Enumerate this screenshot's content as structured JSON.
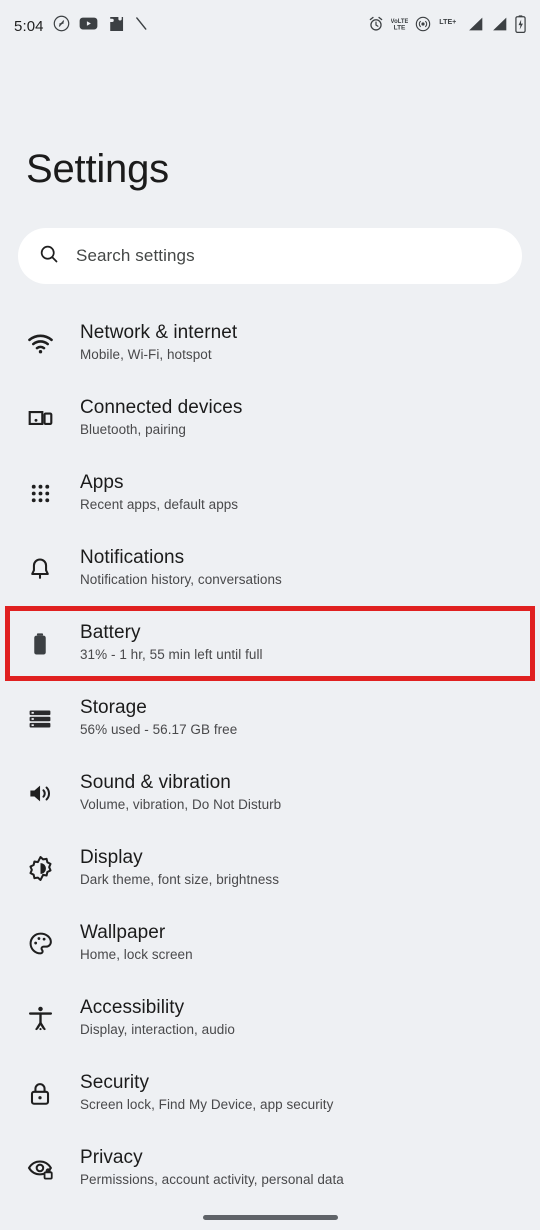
{
  "status_bar": {
    "time": "5:04",
    "left_icons": [
      "shazam-icon",
      "youtube-icon",
      "puzzle-piece-icon",
      "slash-icon"
    ],
    "right_icons": [
      "alarm-icon",
      "volte-icon",
      "hotspot-icon",
      "lte-plus-icon",
      "signal-bars-1-icon",
      "signal-bars-2-icon",
      "battery-charging-icon"
    ],
    "network_label": "LTE+",
    "volte_label_top": "VoLTE",
    "volte_label_bottom": "LTE"
  },
  "header": {
    "title": "Settings"
  },
  "search": {
    "placeholder": "Search settings",
    "icon": "search-icon"
  },
  "highlight": {
    "color": "#e02020",
    "target": "battery"
  },
  "items": [
    {
      "key": "network-internet",
      "icon": "wifi-icon",
      "title": "Network & internet",
      "subtitle": "Mobile, Wi-Fi, hotspot",
      "highlighted": false
    },
    {
      "key": "connected-devices",
      "icon": "devices-icon",
      "title": "Connected devices",
      "subtitle": "Bluetooth, pairing",
      "highlighted": false
    },
    {
      "key": "apps",
      "icon": "apps-grid-icon",
      "title": "Apps",
      "subtitle": "Recent apps, default apps",
      "highlighted": false
    },
    {
      "key": "notifications",
      "icon": "bell-icon",
      "title": "Notifications",
      "subtitle": "Notification history, conversations",
      "highlighted": false
    },
    {
      "key": "battery",
      "icon": "battery-icon",
      "title": "Battery",
      "subtitle": "31% - 1 hr, 55 min left until full",
      "highlighted": true
    },
    {
      "key": "storage",
      "icon": "storage-icon",
      "title": "Storage",
      "subtitle": "56% used - 56.17 GB free",
      "highlighted": false
    },
    {
      "key": "sound-vibration",
      "icon": "volume-icon",
      "title": "Sound & vibration",
      "subtitle": "Volume, vibration, Do Not Disturb",
      "highlighted": false
    },
    {
      "key": "display",
      "icon": "brightness-icon",
      "title": "Display",
      "subtitle": "Dark theme, font size, brightness",
      "highlighted": false
    },
    {
      "key": "wallpaper",
      "icon": "palette-icon",
      "title": "Wallpaper",
      "subtitle": "Home, lock screen",
      "highlighted": false
    },
    {
      "key": "accessibility",
      "icon": "accessibility-icon",
      "title": "Accessibility",
      "subtitle": "Display, interaction, audio",
      "highlighted": false
    },
    {
      "key": "security",
      "icon": "lock-icon",
      "title": "Security",
      "subtitle": "Screen lock, Find My Device, app security",
      "highlighted": false
    },
    {
      "key": "privacy",
      "icon": "eye-lock-icon",
      "title": "Privacy",
      "subtitle": "Permissions, account activity, personal data",
      "highlighted": false
    }
  ],
  "nav_bar": {
    "handle": "home-gesture-handle"
  }
}
